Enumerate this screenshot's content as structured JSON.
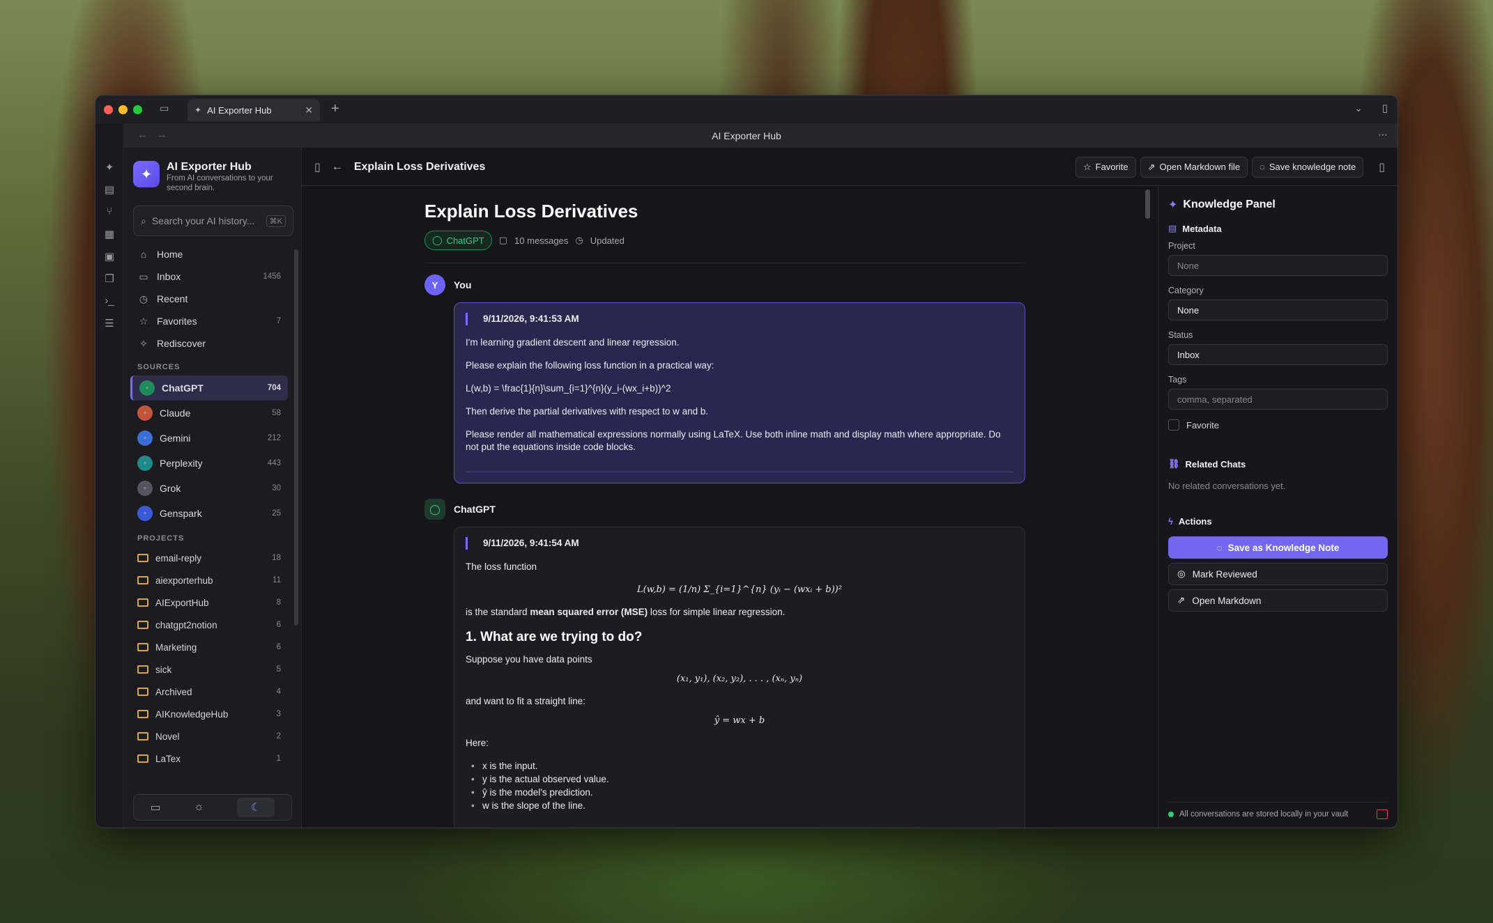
{
  "browser": {
    "tab_title": "AI Exporter Hub",
    "url_title": "AI Exporter Hub"
  },
  "brand": {
    "name": "AI Exporter Hub",
    "tagline": "From AI conversations to your second brain."
  },
  "search": {
    "placeholder": "Search your AI history...",
    "shortcut": "⌘K"
  },
  "nav": [
    {
      "label": "Home",
      "count": "",
      "icon": "home-icon"
    },
    {
      "label": "Inbox",
      "count": "1456",
      "icon": "inbox-icon"
    },
    {
      "label": "Recent",
      "count": "",
      "icon": "clock-icon"
    },
    {
      "label": "Favorites",
      "count": "7",
      "icon": "star-icon"
    },
    {
      "label": "Rediscover",
      "count": "",
      "icon": "sparkle-icon"
    }
  ],
  "sources_heading": "SOURCES",
  "sources": [
    {
      "label": "ChatGPT",
      "count": "704",
      "color": "#1f8a5b"
    },
    {
      "label": "Claude",
      "count": "58",
      "color": "#c2553a"
    },
    {
      "label": "Gemini",
      "count": "212",
      "color": "#3a6fd8"
    },
    {
      "label": "Perplexity",
      "count": "443",
      "color": "#1e8a8a"
    },
    {
      "label": "Grok",
      "count": "30",
      "color": "#555560"
    },
    {
      "label": "Genspark",
      "count": "25",
      "color": "#3a5ad8"
    }
  ],
  "projects_heading": "PROJECTS",
  "projects": [
    {
      "label": "email-reply",
      "count": "18"
    },
    {
      "label": "aiexporterhub",
      "count": "11"
    },
    {
      "label": "AIExportHub",
      "count": "8"
    },
    {
      "label": "chatgpt2notion",
      "count": "6"
    },
    {
      "label": "Marketing",
      "count": "6"
    },
    {
      "label": "sick",
      "count": "5"
    },
    {
      "label": "Archived",
      "count": "4"
    },
    {
      "label": "AIKnowledgeHub",
      "count": "3"
    },
    {
      "label": "Novel",
      "count": "2"
    },
    {
      "label": "LaTex",
      "count": "1"
    }
  ],
  "header": {
    "title": "Explain Loss Derivatives",
    "favorite": "Favorite",
    "open_md": "Open Markdown file",
    "save_note": "Save knowledge note"
  },
  "conversation": {
    "title": "Explain Loss Derivatives",
    "source": "ChatGPT",
    "messages": "10 messages",
    "updated": "Updated",
    "user_name": "You",
    "user_initial": "Y",
    "user_time": "9/11/2026, 9:41:53 AM",
    "user_lines": [
      "I'm learning gradient descent and linear regression.",
      "Please explain the following loss function in a practical way:",
      "L(w,b) = \\frac{1}{n}\\sum_{i=1}^{n}(y_i-(wx_i+b))^2",
      "Then derive the partial derivatives with respect to w and b.",
      "Please render all mathematical expressions normally using LaTeX. Use both inline math and display math where appropriate. Do not put the equations inside code blocks."
    ],
    "ai_name": "ChatGPT",
    "ai_time": "9/11/2026, 9:41:54 AM",
    "ai_p1": "The loss function",
    "ai_math1": "L(w,b) = (1/n) Σ_{i=1}^{n} (yᵢ − (wxᵢ + b))²",
    "ai_p2_pre": "is the standard ",
    "ai_p2_bold": "mean squared error (MSE)",
    "ai_p2_post": " loss for simple linear regression.",
    "ai_h2": "1. What are we trying to do?",
    "ai_p3": "Suppose you have data points",
    "ai_math2": "(x₁, y₁), (x₂, y₂), . . . , (xₙ, yₙ)",
    "ai_p4": "and want to fit a straight line:",
    "ai_math3": "ŷ = wx + b",
    "ai_p5": "Here:",
    "ai_list": [
      "x is the input.",
      "y is the actual observed value.",
      "ŷ is the model's prediction.",
      "w is the slope of the line."
    ]
  },
  "panel": {
    "title": "Knowledge Panel",
    "metadata": "Metadata",
    "project_label": "Project",
    "project_placeholder": "None",
    "category_label": "Category",
    "category_value": "None",
    "status_label": "Status",
    "status_value": "Inbox",
    "tags_label": "Tags",
    "tags_placeholder": "comma, separated",
    "favorite_label": "Favorite",
    "related_heading": "Related Chats",
    "related_empty": "No related conversations yet.",
    "actions_heading": "Actions",
    "save_btn": "Save as Knowledge Note",
    "reviewed_btn": "Mark Reviewed",
    "open_md_btn": "Open Markdown",
    "footer": "All conversations are stored locally in your vault"
  },
  "colors": {
    "accent": "#7366f0",
    "chatgpt_green": "#3ec98a"
  }
}
